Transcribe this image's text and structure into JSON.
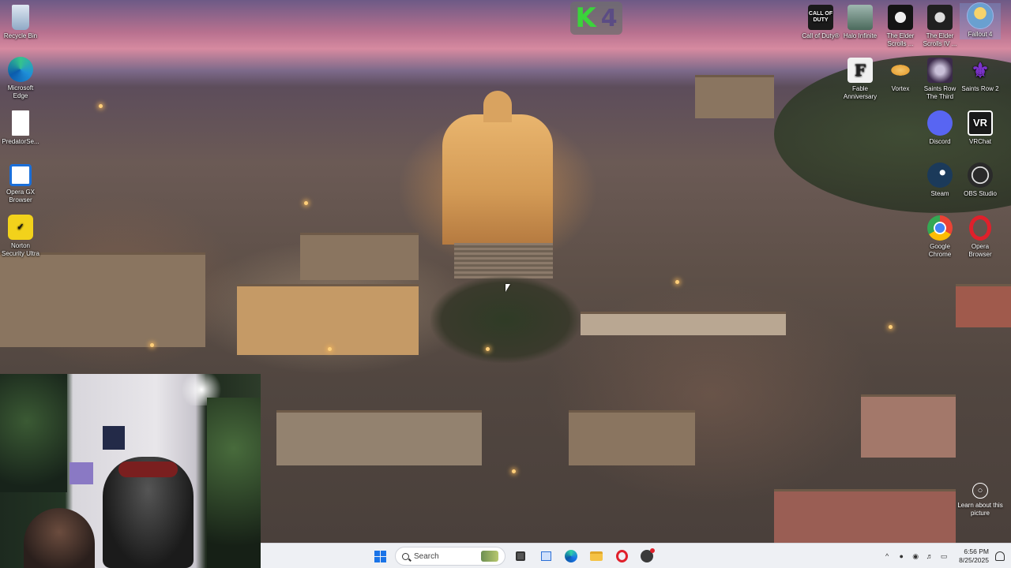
{
  "desktop": {
    "left_icons": [
      {
        "label": "Recycle Bin",
        "icon": "recycle-bin-icon",
        "color": "#9fb8d6"
      },
      {
        "label": "Microsoft Edge",
        "icon": "edge-icon",
        "color": "#1f8fd8"
      },
      {
        "label": "PredatorSe...",
        "icon": "file-icon",
        "color": "#ffffff"
      },
      {
        "label": "Opera GX Browser",
        "icon": "opera-gx-icon",
        "color": "#1b6fd9"
      },
      {
        "label": "Norton Security Ultra",
        "icon": "norton-icon",
        "color": "#f2d21b"
      }
    ],
    "right_icons": [
      {
        "label": "Call of Duty®",
        "icon": "call-of-duty-icon",
        "color": "#1a1a1a",
        "glyph": "CALL OF DUTY"
      },
      {
        "label": "Halo Infinite",
        "icon": "halo-icon",
        "color": "#5a7a6a",
        "glyph": ""
      },
      {
        "label": "The Elder Scrolls ...",
        "icon": "elder-scrolls-icon",
        "color": "#141414",
        "glyph": ""
      },
      {
        "label": "The Elder Scrolls IV ...",
        "icon": "elder-scrolls-iv-icon",
        "color": "#202020",
        "glyph": ""
      },
      {
        "label": "Fallout 4",
        "icon": "fallout-4-icon",
        "color": "#6aa0d0",
        "glyph": ""
      },
      {
        "label": "Fable Anniversary",
        "icon": "fable-icon",
        "color": "#f1f1f1",
        "glyph": "F"
      },
      {
        "label": "Vortex",
        "icon": "vortex-icon",
        "color": "#e8a43a",
        "glyph": ""
      },
      {
        "label": "Saints Row The Third",
        "icon": "saints-row-the-third-icon",
        "color": "#3b2a4a",
        "glyph": ""
      },
      {
        "label": "Saints Row 2",
        "icon": "saints-row-2-icon",
        "color": "#6b2fb3",
        "glyph": "⚜"
      },
      {
        "label": "Discord",
        "icon": "discord-icon",
        "color": "#5865f2",
        "glyph": ""
      },
      {
        "label": "VRChat",
        "icon": "vrchat-icon",
        "color": "#1a1a1a",
        "glyph": "VR"
      },
      {
        "label": "Steam",
        "icon": "steam-icon",
        "color": "#1b3a5a",
        "glyph": ""
      },
      {
        "label": "OBS Studio",
        "icon": "obs-icon",
        "color": "#2a2a2a",
        "glyph": ""
      },
      {
        "label": "Google Chrome",
        "icon": "chrome-icon",
        "color": "#34a853",
        "glyph": ""
      },
      {
        "label": "Opera Browser",
        "icon": "opera-icon",
        "color": "#e0202b",
        "glyph": "O"
      }
    ],
    "selected_icon": "Fallout 4",
    "learn_picture_label": "Learn about this picture"
  },
  "badge": {
    "letter": "K",
    "number": "4",
    "letter_color": "#3bd43b",
    "number_color": "#5b4c84"
  },
  "taskbar": {
    "search_placeholder": "Search",
    "apps": [
      "start-icon",
      "search",
      "task-view-icon",
      "widgets-icon",
      "edge-icon",
      "file-explorer-icon",
      "opera-icon",
      "recording-app-icon"
    ],
    "tray": {
      "chevron": "^",
      "time": "6:56 PM",
      "date": "8/25/2025"
    }
  }
}
